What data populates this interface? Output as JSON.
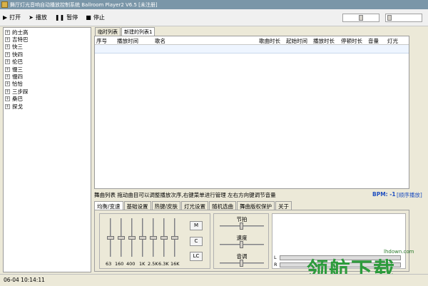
{
  "window": {
    "title": "舞厅灯光音响自动播放控制系统 Ballroom Player2 V6.5 [未注册]"
  },
  "toolbar": {
    "open": {
      "icon": "play-icon",
      "label": "打开"
    },
    "play": {
      "icon": "arrow-icon",
      "label": "播放"
    },
    "pause": {
      "icon": "pause-icon",
      "label": "暂停"
    },
    "stop": {
      "icon": "stop-icon",
      "label": "停止"
    }
  },
  "dance_tree": [
    {
      "label": "的士高"
    },
    {
      "label": "吉特巴"
    },
    {
      "label": "快三"
    },
    {
      "label": "快四"
    },
    {
      "label": "伦巴"
    },
    {
      "label": "慢三"
    },
    {
      "label": "慢四"
    },
    {
      "label": "恰恰"
    },
    {
      "label": "三步踩"
    },
    {
      "label": "桑巴"
    },
    {
      "label": "探戈"
    }
  ],
  "playlist_tabs": [
    {
      "label": "临时列表",
      "active": false
    },
    {
      "label": "新建的列表1",
      "active": true
    }
  ],
  "table": {
    "columns": [
      "序号",
      "播放时间",
      "歌名",
      "歌曲时长",
      "起始时间",
      "播放时长",
      "停顿时长",
      "音量",
      "灯光"
    ]
  },
  "status": {
    "hint": "舞曲列表 拖动曲目可以调整播放次序,右键菜单进行管理 左右方向键调节音量",
    "bpm": "BPM: -1",
    "mode": "[顺序播放]"
  },
  "settings_tabs": [
    {
      "label": "均衡/变速",
      "active": true
    },
    {
      "label": "基础设置",
      "active": false
    },
    {
      "label": "热键/皮肤",
      "active": false
    },
    {
      "label": "灯光设置",
      "active": false
    },
    {
      "label": "随机选曲",
      "active": false
    },
    {
      "label": "舞曲版权保护",
      "active": false
    },
    {
      "label": "关于",
      "active": false
    }
  ],
  "equalizer": {
    "bands": [
      "63",
      "160",
      "400",
      "1K",
      "2.5K",
      "6.3K",
      "16K"
    ],
    "levels": [
      0.5,
      0.5,
      0.5,
      0.5,
      0.5,
      0.5,
      0.5
    ],
    "buttons": [
      "M",
      "C",
      "LC"
    ]
  },
  "mixer": {
    "beat": "节拍",
    "speed": "速度",
    "pitch": "音调"
  },
  "meters": {
    "left": "L",
    "right": "R"
  },
  "watermark": {
    "url": "lhdown.com",
    "text": "领航下载"
  },
  "statusbar": {
    "datetime": "06-04 10:14:11"
  }
}
